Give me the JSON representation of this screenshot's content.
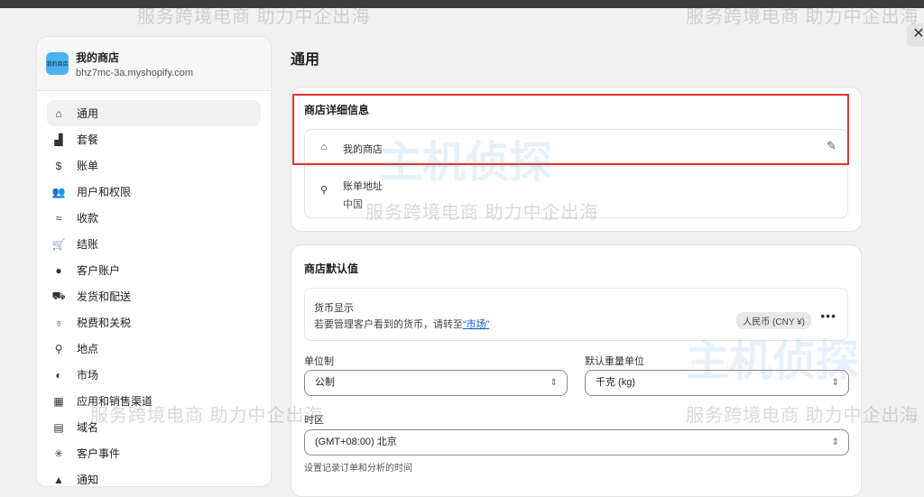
{
  "store": {
    "name": "我的商店",
    "logo_text": "我的商店",
    "domain": "bhz7mc-3a.myshopify.com"
  },
  "sidebar": {
    "items": [
      {
        "label": "通用",
        "icon": "store-icon",
        "glyph": "⌂"
      },
      {
        "label": "套餐",
        "icon": "plan-icon",
        "glyph": "▟"
      },
      {
        "label": "账单",
        "icon": "billing-icon",
        "glyph": "$"
      },
      {
        "label": "用户和权限",
        "icon": "users-icon",
        "glyph": "👥"
      },
      {
        "label": "收款",
        "icon": "payments-icon",
        "glyph": "≈"
      },
      {
        "label": "结账",
        "icon": "cart-icon",
        "glyph": "🛒"
      },
      {
        "label": "客户账户",
        "icon": "person-icon",
        "glyph": "●"
      },
      {
        "label": "发货和配送",
        "icon": "truck-icon",
        "glyph": "⛟"
      },
      {
        "label": "税费和关税",
        "icon": "tax-icon",
        "glyph": "♁"
      },
      {
        "label": "地点",
        "icon": "location-icon",
        "glyph": "⚲"
      },
      {
        "label": "市场",
        "icon": "globe-icon",
        "glyph": "◐"
      },
      {
        "label": "应用和销售渠道",
        "icon": "apps-icon",
        "glyph": "▦"
      },
      {
        "label": "域名",
        "icon": "domain-icon",
        "glyph": "▤"
      },
      {
        "label": "客户事件",
        "icon": "events-icon",
        "glyph": "✳"
      },
      {
        "label": "通知",
        "icon": "bell-icon",
        "glyph": "▲"
      }
    ]
  },
  "main": {
    "title": "通用",
    "details": {
      "title": "商店详细信息",
      "store_name": "我的商店",
      "address_label": "账单地址",
      "address_value": "中国"
    },
    "defaults": {
      "title": "商店默认值",
      "currency_label": "货币显示",
      "currency_hint": "若要管理客户看到的货币，请转至",
      "currency_link": "“市场”",
      "currency_value": "人民币 (CNY ¥)",
      "unit_label": "单位制",
      "unit_value": "公制",
      "weight_label": "默认重量单位",
      "weight_value": "千克 (kg)",
      "tz_label": "时区",
      "tz_value": "(GMT+08:00) 北京",
      "tz_hint": "设置记录订单和分析的时间"
    }
  },
  "watermark": {
    "text": "服务跨境电商 助力中企出海",
    "logo": "主机侦探"
  }
}
